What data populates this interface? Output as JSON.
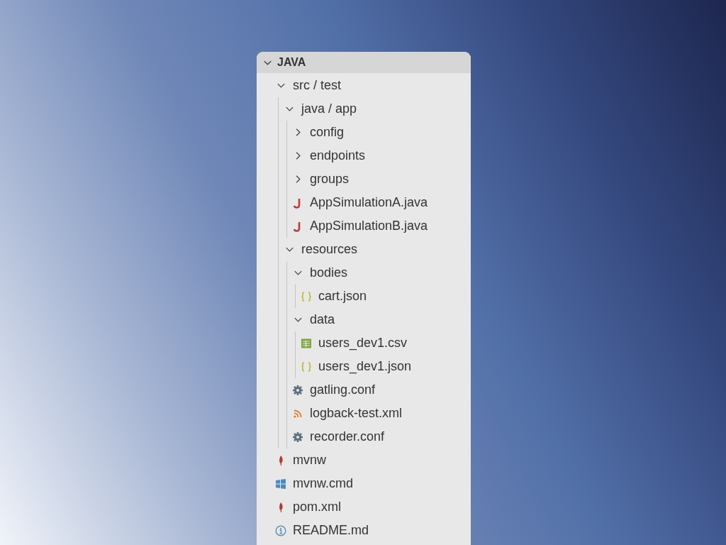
{
  "explorer": {
    "title": "JAVA",
    "expanded": true,
    "tree": [
      {
        "kind": "folder",
        "label": "src / test",
        "expanded": true,
        "children": [
          {
            "kind": "folder",
            "label": "java / app",
            "expanded": true,
            "children": [
              {
                "kind": "folder",
                "label": "config",
                "expanded": false
              },
              {
                "kind": "folder",
                "label": "endpoints",
                "expanded": false
              },
              {
                "kind": "folder",
                "label": "groups",
                "expanded": false
              },
              {
                "kind": "java",
                "label": "AppSimulationA.java"
              },
              {
                "kind": "java",
                "label": "AppSimulationB.java"
              }
            ]
          },
          {
            "kind": "folder",
            "label": "resources",
            "expanded": true,
            "children": [
              {
                "kind": "folder",
                "label": "bodies",
                "expanded": true,
                "children": [
                  {
                    "kind": "json",
                    "label": "cart.json"
                  }
                ]
              },
              {
                "kind": "folder",
                "label": "data",
                "expanded": true,
                "children": [
                  {
                    "kind": "csv",
                    "label": "users_dev1.csv"
                  },
                  {
                    "kind": "json",
                    "label": "users_dev1.json"
                  }
                ]
              },
              {
                "kind": "settings",
                "label": "gatling.conf"
              },
              {
                "kind": "feed",
                "label": "logback-test.xml"
              },
              {
                "kind": "settings",
                "label": "recorder.conf"
              }
            ]
          }
        ]
      },
      {
        "kind": "feather",
        "label": "mvnw"
      },
      {
        "kind": "windows",
        "label": "mvnw.cmd"
      },
      {
        "kind": "feather",
        "label": "pom.xml"
      },
      {
        "kind": "info",
        "label": "README.md"
      }
    ]
  }
}
